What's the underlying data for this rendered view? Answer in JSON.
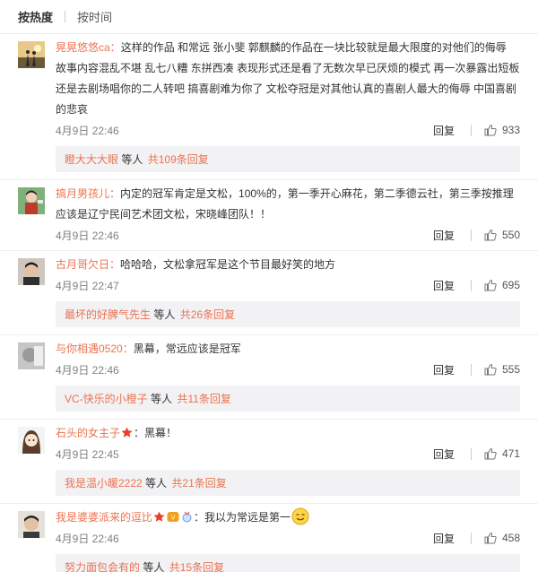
{
  "tabs": {
    "hot": "按热度",
    "time": "按时间"
  },
  "reply_label": "回复",
  "more_suffix": "等人",
  "comments": [
    {
      "user": "晃晃悠悠ca：",
      "text": "这样的作品 和常远 张小斐 郭麒麟的作品在一块比较就是最大限度的对他们的侮辱 故事内容混乱不堪 乱七八糟 东拼西凑 表现形式还是看了无数次早已厌烦的模式  再一次暴露出短板 还是去剧场唱你的二人转吧 搞喜剧难为你了  文松夺冠是对其他认真的喜剧人最大的侮辱 中国喜剧的悲哀",
      "time": "4月9日 22:46",
      "likes": "933",
      "sub_user": "瞪大大大眼",
      "sub_count": "共109条回复"
    },
    {
      "user": "搞月男孩儿：",
      "text": "内定的冠军肯定是文松，100%的，第一季开心麻花，第二季德云社，第三季按推理应该是辽宁民间艺术团文松，宋晓峰团队！！",
      "time": "4月9日 22:46",
      "likes": "550"
    },
    {
      "user": "古月哥欠日：",
      "text": "哈哈哈，文松拿冠军是这个节目最好笑的地方",
      "time": "4月9日 22:47",
      "likes": "695",
      "sub_user": "最坏的好脾气先生",
      "sub_count": "共26条回复"
    },
    {
      "user": "与你相遇0520：",
      "text": "黑幕，常远应该是冠军",
      "time": "4月9日 22:46",
      "likes": "555",
      "sub_user": "VC-快乐的小橙子",
      "sub_count": "共11条回复"
    },
    {
      "user": "石头的女主子",
      "text": "：黑幕！",
      "time": "4月9日 22:45",
      "likes": "471",
      "sub_user": "我是温小暖2222",
      "sub_count": "共21条回复"
    },
    {
      "user": "我是婆婆派来的逗比",
      "text": "：我以为常远是第一",
      "time": "4月9日 22:46",
      "likes": "458",
      "sub_user": "努力面包会有的",
      "sub_count": "共15条回复"
    }
  ]
}
